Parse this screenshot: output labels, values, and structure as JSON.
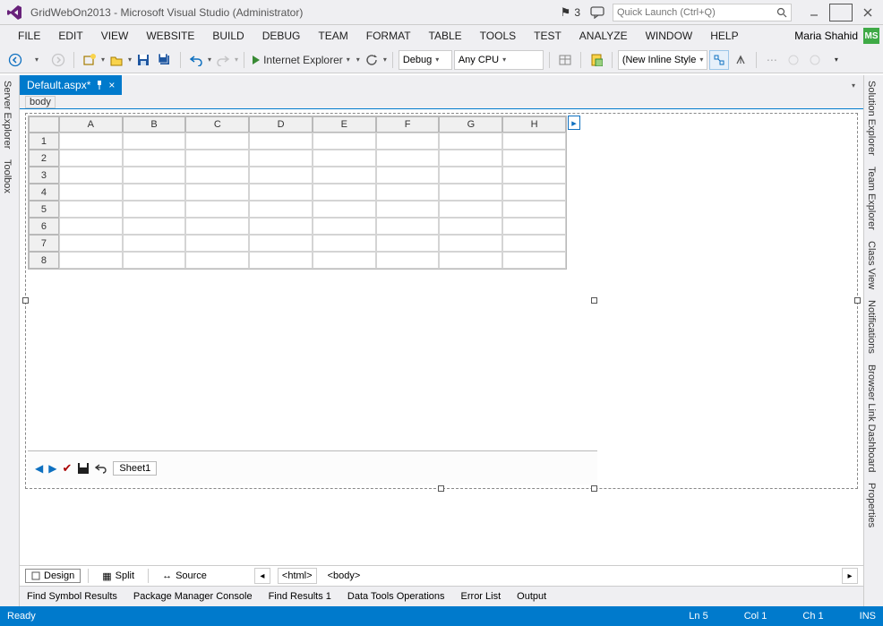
{
  "title": "GridWebOn2013 - Microsoft Visual Studio (Administrator)",
  "notification_count": "3",
  "quick_launch_placeholder": "Quick Launch (Ctrl+Q)",
  "user": {
    "name": "Maria Shahid",
    "initials": "MS"
  },
  "menu": [
    "FILE",
    "EDIT",
    "VIEW",
    "WEBSITE",
    "BUILD",
    "DEBUG",
    "TEAM",
    "FORMAT",
    "TABLE",
    "TOOLS",
    "TEST",
    "ANALYZE",
    "WINDOW",
    "HELP"
  ],
  "toolbar": {
    "run_target": "Internet Explorer",
    "config": "Debug",
    "platform": "Any CPU",
    "style_dropdown": "(New Inline Style"
  },
  "left_tabs": [
    "Server Explorer",
    "Toolbox"
  ],
  "right_tabs": [
    "Solution Explorer",
    "Team Explorer",
    "Class View",
    "Notifications",
    "Browser Link Dashboard",
    "Properties"
  ],
  "doc_tab": {
    "name": "Default.aspx*"
  },
  "nav_context": "body",
  "grid": {
    "columns": [
      "A",
      "B",
      "C",
      "D",
      "E",
      "F",
      "G",
      "H"
    ],
    "rows": [
      "1",
      "2",
      "3",
      "4",
      "5",
      "6",
      "7",
      "8"
    ],
    "sheet": "Sheet1"
  },
  "views": {
    "design": "Design",
    "split": "Split",
    "source": "Source"
  },
  "path": {
    "p1": "<html>",
    "p2": "<body>"
  },
  "tool_tabs": [
    "Find Symbol Results",
    "Package Manager Console",
    "Find Results 1",
    "Data Tools Operations",
    "Error List",
    "Output"
  ],
  "status": {
    "ready": "Ready",
    "line": "Ln 5",
    "col": "Col 1",
    "ch": "Ch 1",
    "ins": "INS"
  }
}
